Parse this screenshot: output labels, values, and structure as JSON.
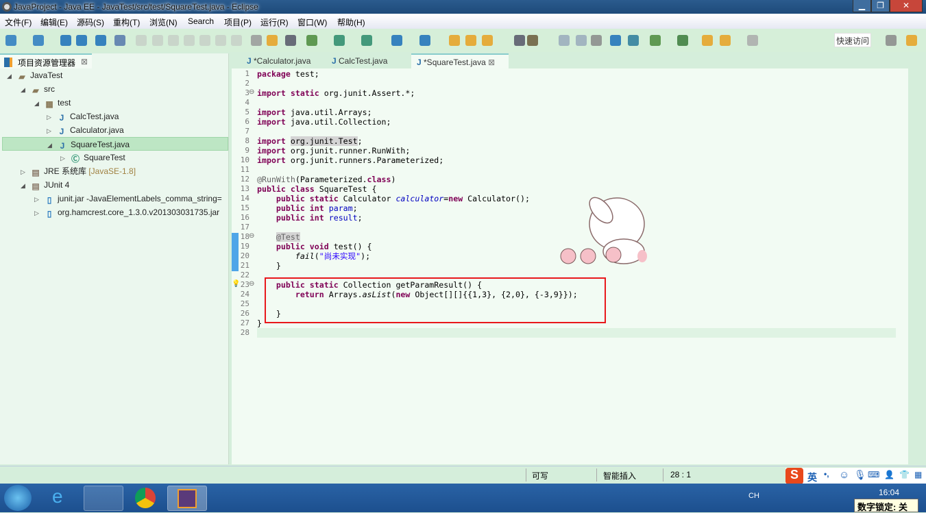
{
  "window": {
    "title": "JavaProject  -  Java EE  -  JavaTest/src/test/SquareTest.java  -  Eclipse",
    "minimize": "▁",
    "restore": "❐",
    "close": "✕"
  },
  "menu": [
    "文件(F)",
    "编辑(E)",
    "源码(S)",
    "重构(T)",
    "浏览(N)",
    "Search",
    "项目(P)",
    "运行(R)",
    "窗口(W)",
    "帮助(H)"
  ],
  "toolbar": {
    "quick_access": "快速访问"
  },
  "explorer": {
    "tab": "项目资源管理器",
    "items": [
      {
        "label": "JavaTest",
        "twisty": "◢",
        "icon": "project-folder-icon"
      },
      {
        "label": "src",
        "twisty": "◢",
        "icon": "source-folder-icon"
      },
      {
        "label": "test",
        "twisty": "◢",
        "icon": "package-icon"
      },
      {
        "label": "CalcTest.java",
        "twisty": "▷",
        "icon": "java-file-icon"
      },
      {
        "label": "Calculator.java",
        "twisty": "▷",
        "icon": "java-file-icon"
      },
      {
        "label": "SquareTest.java",
        "twisty": "◢",
        "icon": "java-file-icon",
        "selected": true
      },
      {
        "label": "SquareTest",
        "twisty": "▷",
        "icon": "class-icon"
      },
      {
        "label": "JRE 系统库",
        "suffix": " [JavaSE-1.8]",
        "twisty": "▷",
        "icon": "library-icon"
      },
      {
        "label": "JUnit 4",
        "twisty": "◢",
        "icon": "library-icon"
      },
      {
        "label": "junit.jar -JavaElementLabels_comma_string=",
        "twisty": "▷",
        "icon": "jar-icon"
      },
      {
        "label": "org.hamcrest.core_1.3.0.v201303031735.jar",
        "twisty": "▷",
        "icon": "jar-icon"
      }
    ]
  },
  "editor": {
    "tabs": [
      {
        "label": "*Calculator.java"
      },
      {
        "label": "CalcTest.java"
      },
      {
        "label": "*SquareTest.java",
        "active": true
      }
    ],
    "lines": [
      [
        [
          "package",
          "k"
        ],
        [
          " test;",
          ""
        ]
      ],
      [],
      [
        [
          "import",
          "k"
        ],
        [
          " ",
          ""
        ],
        [
          "static",
          "k"
        ],
        [
          " org.junit.Assert.*;",
          ""
        ]
      ],
      [],
      [
        [
          "import",
          "k"
        ],
        [
          " java.util.Arrays;",
          ""
        ]
      ],
      [
        [
          "import",
          "k"
        ],
        [
          " java.util.Collection;",
          ""
        ]
      ],
      [],
      [
        [
          "import",
          "k"
        ],
        [
          " ",
          ""
        ],
        [
          "org.junit.Test",
          "hl"
        ],
        [
          ";",
          ""
        ]
      ],
      [
        [
          "import",
          "k"
        ],
        [
          " org.junit.runner.RunWith;",
          ""
        ]
      ],
      [
        [
          "import",
          "k"
        ],
        [
          " org.junit.runners.Parameterized;",
          ""
        ]
      ],
      [],
      [
        [
          "@RunWith",
          "a"
        ],
        [
          "(Parameterized.",
          ""
        ],
        [
          "class",
          "k"
        ],
        [
          ")",
          ""
        ]
      ],
      [
        [
          "public",
          "k"
        ],
        [
          " ",
          ""
        ],
        [
          "class",
          "k"
        ],
        [
          " SquareTest {",
          ""
        ]
      ],
      [
        [
          "    ",
          ""
        ],
        [
          "public",
          "k"
        ],
        [
          " ",
          ""
        ],
        [
          "static",
          "k"
        ],
        [
          " Calculator ",
          ""
        ],
        [
          "calculator",
          "sf"
        ],
        [
          "=",
          ""
        ],
        [
          "new",
          "k"
        ],
        [
          " Calculator();",
          ""
        ]
      ],
      [
        [
          "    ",
          ""
        ],
        [
          "public",
          "k"
        ],
        [
          " ",
          ""
        ],
        [
          "int",
          "k"
        ],
        [
          " ",
          ""
        ],
        [
          "param",
          "f"
        ],
        [
          ";",
          ""
        ]
      ],
      [
        [
          "    ",
          ""
        ],
        [
          "public",
          "k"
        ],
        [
          " ",
          ""
        ],
        [
          "int",
          "k"
        ],
        [
          " ",
          ""
        ],
        [
          "result",
          "f"
        ],
        [
          ";",
          ""
        ]
      ],
      [],
      [
        [
          "    ",
          ""
        ],
        [
          "@Test",
          "a hl"
        ]
      ],
      [
        [
          "    ",
          ""
        ],
        [
          "public",
          "k"
        ],
        [
          " ",
          ""
        ],
        [
          "void",
          "k"
        ],
        [
          " test() {",
          ""
        ]
      ],
      [
        [
          "        ",
          ""
        ],
        [
          "fail",
          "i"
        ],
        [
          "(",
          ""
        ],
        [
          "\"尚未实现\"",
          "s"
        ],
        [
          ");",
          ""
        ]
      ],
      [
        [
          "    }",
          ""
        ]
      ],
      [],
      [
        [
          "    ",
          ""
        ],
        [
          "public",
          "k"
        ],
        [
          " ",
          ""
        ],
        [
          "static",
          "k"
        ],
        [
          " Collection getParamResult() {",
          ""
        ]
      ],
      [
        [
          "        ",
          ""
        ],
        [
          "return",
          "k"
        ],
        [
          " Arrays.",
          ""
        ],
        [
          "asList",
          "i"
        ],
        [
          "(",
          ""
        ],
        [
          "new",
          "k"
        ],
        [
          " Object[][]{{1,3}, {2,0}, {-3,9}});",
          ""
        ]
      ],
      [],
      [
        [
          "    }",
          ""
        ]
      ],
      [
        [
          "}",
          ""
        ]
      ],
      []
    ]
  },
  "status": {
    "writable": "可写",
    "insert_mode": "智能插入",
    "position": "28 : 1"
  },
  "ime": {
    "mode": "英",
    "punct": "•,"
  },
  "taskbar": {
    "clock": "16:04",
    "lang": "CH",
    "numlock": "数字锁定: 关"
  }
}
